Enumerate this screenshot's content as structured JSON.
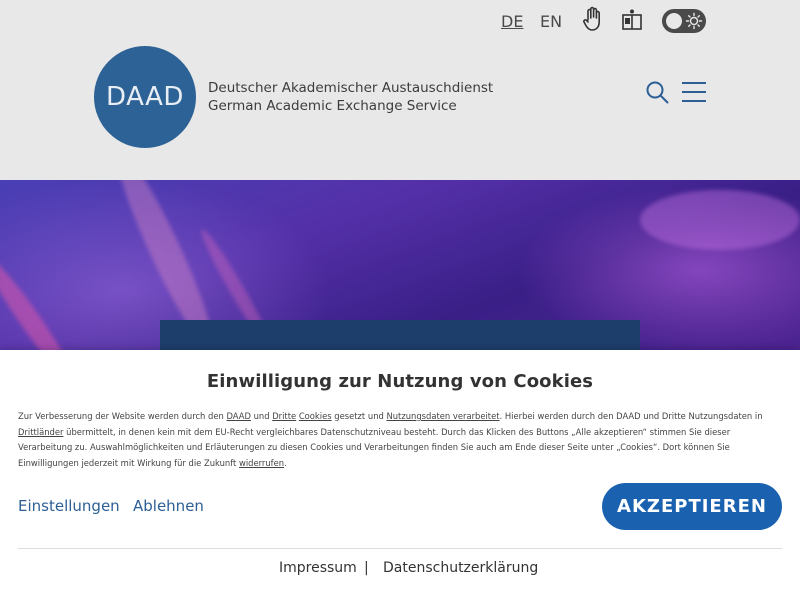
{
  "header": {
    "languages": [
      "DE",
      "EN"
    ],
    "logo_text": "DAAD",
    "org_name_de": "Deutscher Akademischer Austauschdienst",
    "org_name_en": "German Academic Exchange Service",
    "icons": [
      "hand-icon",
      "book-icon",
      "theme-toggle",
      "search-icon",
      "menu-icon"
    ]
  },
  "cookie_banner": {
    "title": "Einwilligung zur Nutzung von Cookies",
    "text": {
      "t1": "Zur Verbesserung der Website werden durch den ",
      "l1": "DAAD",
      "t2": " und ",
      "l2": "Dritte",
      "t3": " ",
      "l3": "Cookies",
      "t4": " gesetzt und ",
      "l4": "Nutzungsdaten verarbeitet",
      "t5": ". Hierbei werden durch den DAAD und Dritte Nutzungsdaten in ",
      "l5": "Drittländer",
      "t6": " übermittelt, in denen kein mit dem EU-Recht vergleichbares Datenschutzniveau besteht. Durch das Klicken des Buttons „Alle akzeptieren“ stimmen Sie dieser Verarbeitung zu. Auswahlmöglichkeiten und Erläuterungen zu diesen Cookies und Verarbeitungen finden Sie auch am Ende dieser Seite unter „Cookies“. Dort können Sie Einwilligungen jederzeit mit Wirkung für die Zukunft ",
      "l6": "widerrufen",
      "t7": "."
    },
    "settings_label": "Einstellungen",
    "reject_label": "Ablehnen",
    "accept_label": "AKZEPTIEREN",
    "footer": {
      "imprint": "Impressum",
      "separator": "|",
      "privacy": "Datenschutzerklärung"
    }
  },
  "colors": {
    "brand_blue": "#2d6296",
    "accept_button": "#1a62b0",
    "link": "#2d5f94"
  }
}
